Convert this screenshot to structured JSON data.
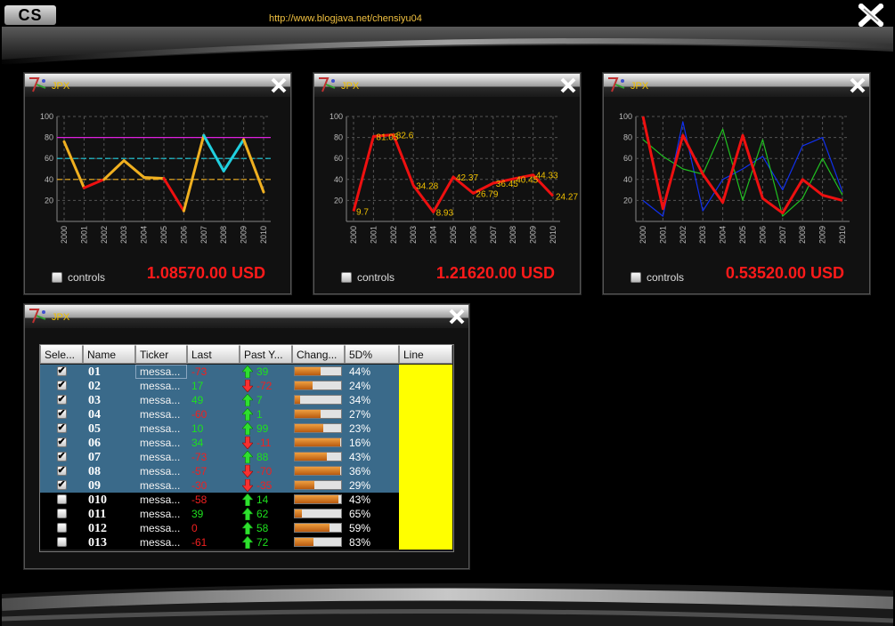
{
  "app": {
    "logo_text": "CS",
    "url": "http://www.blogjava.net/chensiyu04"
  },
  "colors": {
    "price": "#ff1a1a",
    "panel_title": "#f0c000",
    "selected_row": "#3a6a8a",
    "line_col": "#ffff00"
  },
  "icons": {
    "app_close": "close-x-icon",
    "panel_logo": "jpx-logo-icon",
    "up_arrow": "green-up-arrow-icon",
    "down_arrow": "red-down-arrow-icon"
  },
  "panels": [
    {
      "title": "JPX",
      "controls_label": "controls",
      "price": "1.08570.00 USD"
    },
    {
      "title": "JPX",
      "controls_label": "controls",
      "price": "1.21620.00 USD"
    },
    {
      "title": "JPX",
      "controls_label": "controls",
      "price": "0.53520.00 USD"
    }
  ],
  "chart_data": [
    {
      "type": "line",
      "x": [
        "2000",
        "2001",
        "2002",
        "2003",
        "2004",
        "2005",
        "2006",
        "2007",
        "2008",
        "2009",
        "2010"
      ],
      "yticks": [
        "20",
        "40",
        "60",
        "80",
        "100"
      ],
      "ylim": [
        0,
        100
      ],
      "grid": true,
      "series": [
        {
          "values": [
            76,
            32,
            40,
            58,
            42,
            41,
            10,
            82,
            48,
            78,
            28
          ]
        }
      ],
      "reference_lines": [
        {
          "value": 80,
          "color": "#e020e0",
          "style": "solid"
        },
        {
          "value": 60,
          "color": "#20d0e0",
          "style": "dashed"
        },
        {
          "value": 40,
          "color": "#f0b020",
          "style": "dashed"
        }
      ]
    },
    {
      "type": "line",
      "x": [
        "2000",
        "2001",
        "2002",
        "2003",
        "2004",
        "2005",
        "2006",
        "2007",
        "2008",
        "2009",
        "2010"
      ],
      "yticks": [
        "20",
        "40",
        "60",
        "80",
        "100"
      ],
      "ylim": [
        0,
        100
      ],
      "grid": true,
      "series": [
        {
          "values": [
            9.7,
            81.05,
            82.6,
            34.28,
            8.93,
            42.37,
            26.79,
            36.45,
            40.45,
            44.33,
            24.27
          ],
          "color": "#ee1010"
        }
      ],
      "data_labels": [
        "9.7",
        "81.05",
        "82.6",
        "34.28",
        "8.93",
        "42.37",
        "26.79",
        "36.45",
        "40.45",
        "44.33",
        "24.27"
      ]
    },
    {
      "type": "line",
      "x": [
        "2000",
        "2001",
        "2002",
        "2003",
        "2004",
        "2005",
        "2006",
        "2007",
        "2008",
        "2009",
        "2010"
      ],
      "yticks": [
        "20",
        "40",
        "60",
        "80",
        "100"
      ],
      "ylim": [
        0,
        100
      ],
      "grid": true,
      "series": [
        {
          "values": [
            20,
            5,
            95,
            10,
            40,
            50,
            62,
            30,
            72,
            80,
            28
          ],
          "color": "#1030ee",
          "width": 1.2
        },
        {
          "values": [
            78,
            62,
            50,
            45,
            88,
            20,
            78,
            5,
            22,
            60,
            25
          ],
          "color": "#20c020",
          "width": 1.2
        },
        {
          "values": [
            100,
            12,
            82,
            45,
            18,
            82,
            22,
            8,
            40,
            25,
            20
          ],
          "color": "#ee1010",
          "width": 3
        }
      ]
    }
  ],
  "table": {
    "panel_title": "JPX",
    "columns": [
      "Sele...",
      "Name",
      "Ticker",
      "Last",
      "Past Y...",
      "Chang...",
      "5D%",
      "Line"
    ],
    "rows": [
      {
        "checked": true,
        "name": "01",
        "ticker": "messa...",
        "last": "-73",
        "past": "39",
        "change": 0.55,
        "d5": "44%"
      },
      {
        "checked": true,
        "name": "02",
        "ticker": "messa...",
        "last": "17",
        "past": "-72",
        "change": 0.38,
        "d5": "24%"
      },
      {
        "checked": true,
        "name": "03",
        "ticker": "messa...",
        "last": "49",
        "past": "7",
        "change": 0.12,
        "d5": "34%"
      },
      {
        "checked": true,
        "name": "04",
        "ticker": "messa...",
        "last": "-60",
        "past": "1",
        "change": 0.55,
        "d5": "27%"
      },
      {
        "checked": true,
        "name": "05",
        "ticker": "messa...",
        "last": "10",
        "past": "99",
        "change": 0.62,
        "d5": "23%"
      },
      {
        "checked": true,
        "name": "06",
        "ticker": "messa...",
        "last": "34",
        "past": "-11",
        "change": 0.98,
        "d5": "16%"
      },
      {
        "checked": true,
        "name": "07",
        "ticker": "messa...",
        "last": "-73",
        "past": "88",
        "change": 0.7,
        "d5": "43%"
      },
      {
        "checked": true,
        "name": "08",
        "ticker": "messa...",
        "last": "-57",
        "past": "-70",
        "change": 0.98,
        "d5": "36%"
      },
      {
        "checked": true,
        "name": "09",
        "ticker": "messa...",
        "last": "-30",
        "past": "-35",
        "change": 0.42,
        "d5": "29%"
      },
      {
        "checked": false,
        "name": "010",
        "ticker": "messa...",
        "last": "-58",
        "past": "14",
        "change": 0.95,
        "d5": "43%"
      },
      {
        "checked": false,
        "name": "011",
        "ticker": "messa...",
        "last": "39",
        "past": "62",
        "change": 0.15,
        "d5": "65%"
      },
      {
        "checked": false,
        "name": "012",
        "ticker": "messa...",
        "last": "0",
        "past": "58",
        "change": 0.75,
        "d5": "59%"
      },
      {
        "checked": false,
        "name": "013",
        "ticker": "messa...",
        "last": "-61",
        "past": "72",
        "change": 0.4,
        "d5": "83%"
      }
    ]
  }
}
